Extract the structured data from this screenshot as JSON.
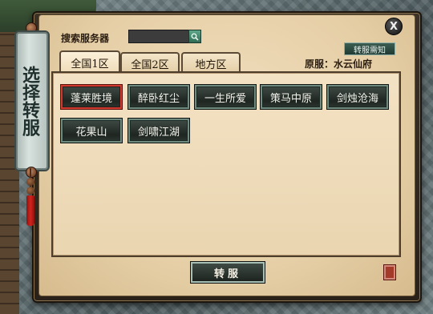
{
  "banner": {
    "title": "选择转服"
  },
  "window": {
    "close_label": "X"
  },
  "search": {
    "label": "搜索服务器",
    "value": "",
    "placeholder": ""
  },
  "tabs": [
    {
      "label": "全国1区",
      "active": true
    },
    {
      "label": "全国2区",
      "active": false
    },
    {
      "label": "地方区",
      "active": false
    }
  ],
  "notice_button": {
    "label": "转服需知"
  },
  "original_server": {
    "label": "原服：",
    "value": "水云仙府"
  },
  "servers": [
    {
      "name": "蓬莱胜境",
      "selected": true
    },
    {
      "name": "醉卧红尘",
      "selected": false
    },
    {
      "name": "一生所爱",
      "selected": false
    },
    {
      "name": "策马中原",
      "selected": false
    },
    {
      "name": "剑烛沧海",
      "selected": false
    },
    {
      "name": "花果山",
      "selected": false
    },
    {
      "name": "剑啸江湖",
      "selected": false
    }
  ],
  "transfer_button": {
    "label": "转服"
  },
  "colors": {
    "selected_border": "#d13a2e",
    "button_border": "#6f8b80",
    "parchment": "#ead5b0"
  }
}
